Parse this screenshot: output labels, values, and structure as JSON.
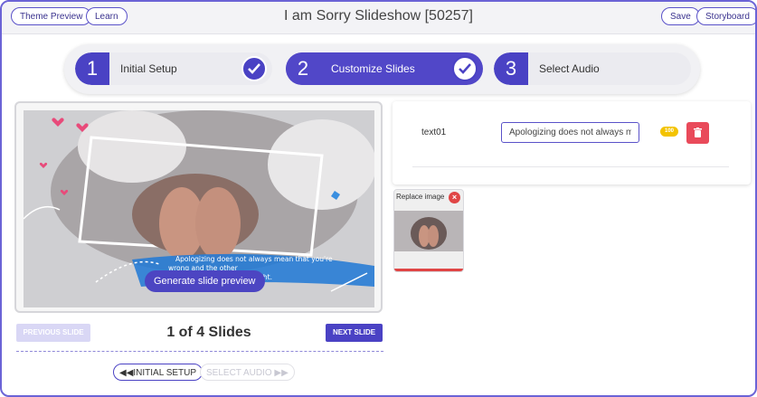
{
  "header": {
    "theme_preview": "Theme Preview",
    "learn": "Learn",
    "title": "I am Sorry Slideshow [50257]",
    "save": "Save",
    "storyboard": "Storyboard"
  },
  "steps": [
    {
      "number": "1",
      "label": "Initial Setup",
      "completed": true
    },
    {
      "number": "2",
      "label": "Customize Slides",
      "completed": true
    },
    {
      "number": "3",
      "label": "Select Audio",
      "completed": false
    }
  ],
  "preview": {
    "overlay_text_1": "Apologizing does not always mean that you're",
    "overlay_text_2": "wrong and the other",
    "overlay_text_3": "right.",
    "generate_button": "Generate slide preview"
  },
  "navigation": {
    "previous": "PREVIOUS SLIDE",
    "counter": "1 of 4 Slides",
    "next": "NEXT SLIDE",
    "initial_setup": "INITIAL SETUP",
    "select_audio": "SELECT AUDIO"
  },
  "text_fields": [
    {
      "label": "text01",
      "value": "Apologizing does not always mean that you're wrong and the other person is right.",
      "char_limit": "100"
    }
  ],
  "image_slot": {
    "label": "Replace image"
  },
  "colors": {
    "accent": "#4a42c4",
    "delete": "#e94a5a",
    "badge": "#f3c300"
  }
}
